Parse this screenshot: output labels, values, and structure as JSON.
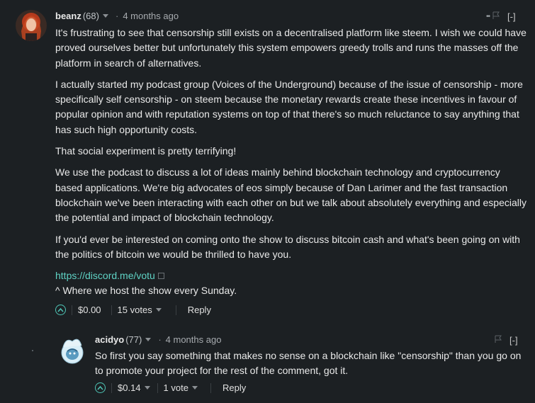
{
  "comments": [
    {
      "author": "beanz",
      "reputation": "(68)",
      "time": "4 months ago",
      "collapse": "[-]",
      "paragraphs": [
        "It's frustrating to see that censorship still exists on a decentralised platform like steem. I wish we could have proved ourselves better but unfortunately this system empowers greedy trolls and runs the masses off the platform in search of alternatives.",
        "I actually started my podcast group (Voices of the Underground) because of the issue of censorship - more specifically self censorship - on steem because the monetary rewards create these incentives in favour of popular opinion and with reputation systems on top of that there's so much reluctance to say anything that has such high opportunity costs.",
        "That social experiment is pretty terrifying!",
        "We use the podcast to discuss a lot of ideas mainly behind blockchain technology and cryptocurrency based applications. We're big advocates of eos simply because of Dan Larimer and the fast transaction blockchain we've been interacting with each other on but we talk about absolutely everything and especially the potential and impact of blockchain technology.",
        "If you'd ever be interested on coming onto the show to discuss bitcoin cash and what's been going on with the politics of bitcoin we would be thrilled to have you."
      ],
      "link": "https://discord.me/votu",
      "link_caption": "^ Where we host the show every Sunday.",
      "payout": "$0.00",
      "votes": "15 votes",
      "reply": "Reply"
    },
    {
      "author": "acidyo",
      "reputation": "(77)",
      "time": "4 months ago",
      "collapse": "[-]",
      "text": "So first you say something that makes no sense on a blockchain like \"censorship\" than you go on to promote your project for the rest of the comment, got it.",
      "payout": "$0.14",
      "votes": "1 vote",
      "reply": "Reply"
    }
  ],
  "colors": {
    "background": "#1c2023",
    "link": "#5fd3c5",
    "upvote": "#4fc6b7"
  },
  "icons": [
    "upvote-icon",
    "flag-icon",
    "external-link-icon",
    "collapse-toggle"
  ]
}
